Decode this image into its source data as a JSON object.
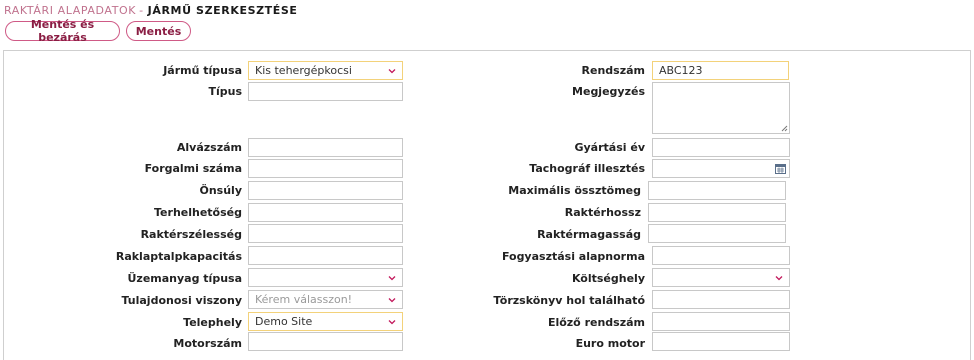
{
  "breadcrumb": {
    "parent": "RAKTÁRI ALAPADATOK",
    "separator": "-",
    "current": "JÁRMŰ SZERKESZTÉSE"
  },
  "toolbar": {
    "save_close_label": "Mentés és bezárás",
    "save_label": "Mentés"
  },
  "form": {
    "vehicle_type": {
      "label": "Jármű típusa",
      "value": "Kis tehergépkocsi"
    },
    "plate": {
      "label": "Rendszám",
      "value": "ABC123"
    },
    "type": {
      "label": "Típus",
      "value": ""
    },
    "note": {
      "label": "Megjegyzés",
      "value": ""
    },
    "chassis": {
      "label": "Alvázszám",
      "value": ""
    },
    "manufacture_year": {
      "label": "Gyártási év",
      "value": ""
    },
    "registration_no": {
      "label": "Forgalmi száma",
      "value": ""
    },
    "tachograph": {
      "label": "Tachográf illesztés",
      "value": ""
    },
    "curb_weight": {
      "label": "Önsúly",
      "value": ""
    },
    "max_total_weight": {
      "label": "Maximális össztömeg",
      "value": ""
    },
    "load_capacity": {
      "label": "Terhelhetőség",
      "value": ""
    },
    "cargo_length": {
      "label": "Raktérhossz",
      "value": ""
    },
    "cargo_width": {
      "label": "Raktérszélesség",
      "value": ""
    },
    "cargo_height": {
      "label": "Raktérmagasság",
      "value": ""
    },
    "pallet_capacity": {
      "label": "Raklaptalpkapacitás",
      "value": ""
    },
    "consumption_norm": {
      "label": "Fogyasztási alapnorma",
      "value": ""
    },
    "fuel_type": {
      "label": "Üzemanyag típusa",
      "value": ""
    },
    "cost_center": {
      "label": "Költséghely",
      "value": ""
    },
    "ownership": {
      "label": "Tulajdonosi viszony",
      "placeholder": "Kérem válasszon!"
    },
    "logbook_location": {
      "label": "Törzskönyv hol található",
      "value": ""
    },
    "site": {
      "label": "Telephely",
      "value": "Demo Site"
    },
    "previous_plate": {
      "label": "Előző rendszám",
      "value": ""
    },
    "engine_no": {
      "label": "Motorszám",
      "value": ""
    },
    "euro_engine": {
      "label": "Euro motor",
      "value": ""
    }
  },
  "colors": {
    "accent": "#cf5a86",
    "highlight_border": "#f3d27a",
    "breadcrumb_parent": "#c0728e"
  },
  "icons": {
    "select": "chevron-down-icon",
    "date": "calendar-icon",
    "textarea": "resize-grip-icon"
  }
}
